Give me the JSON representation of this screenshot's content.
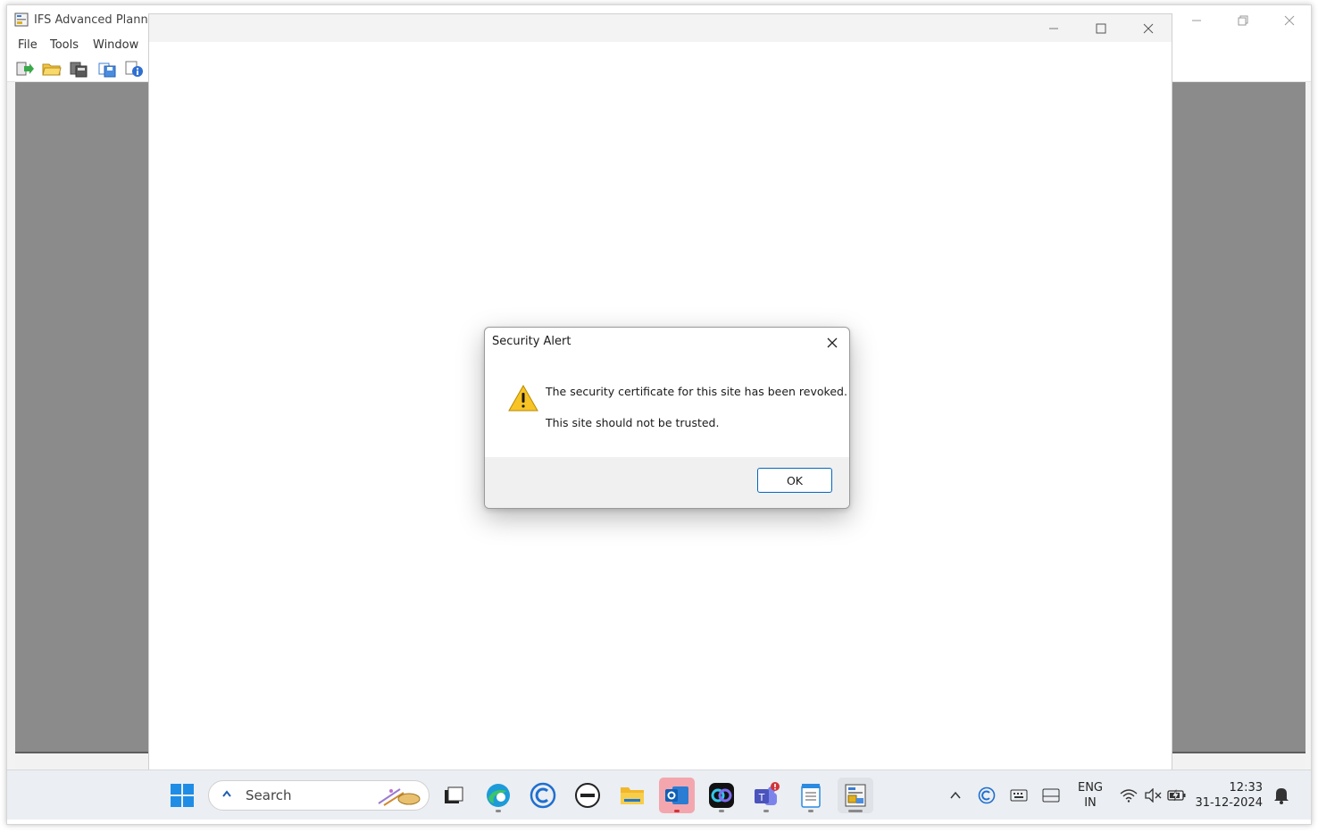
{
  "app": {
    "title": "IFS Advanced Plannin",
    "menu": [
      "File",
      "Tools",
      "Window"
    ],
    "toolbar_icons": [
      "exit-icon",
      "open-folder-icon",
      "database-icon",
      "save-icon",
      "info-icon"
    ]
  },
  "dialog": {
    "title": "Security Alert",
    "message1": "The security certificate for this site has been revoked.",
    "message2": "This site should not be trusted.",
    "ok_label": "OK"
  },
  "taskbar": {
    "search_placeholder": "Search",
    "apps": [
      "start-icon",
      "task-view-icon",
      "edge-icon",
      "copilot-icon",
      "dell-icon",
      "file-explorer-icon",
      "outlook-icon",
      "webex-icon",
      "teams-icon",
      "notepad-icon",
      "ifs-app-icon"
    ],
    "language_line1": "ENG",
    "language_line2": "IN",
    "time": "12:33",
    "date": "31-12-2024"
  },
  "colors": {
    "accent": "#0067c0",
    "warning": "#f7c325",
    "workspace": "#8b8b8b"
  }
}
